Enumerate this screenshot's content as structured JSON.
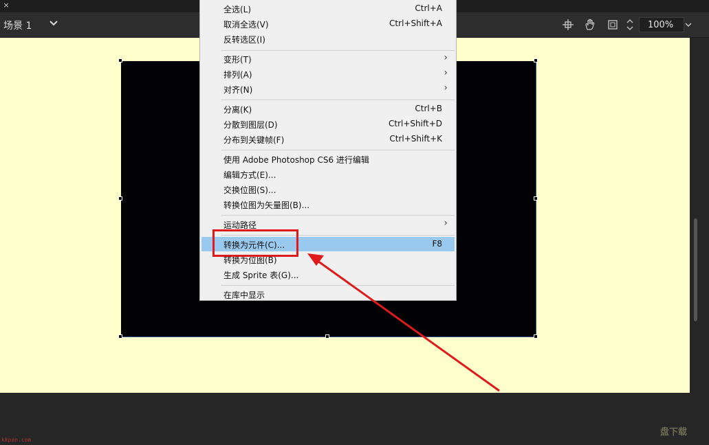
{
  "tab": {
    "close_glyph": "×"
  },
  "toolbar": {
    "scene_label": "场景 1",
    "zoom_value": "100%",
    "icons": [
      "center-stage-icon",
      "hand-tool-icon",
      "clip-stage-icon"
    ]
  },
  "context_menu": {
    "items": [
      {
        "label": "全选(L)",
        "shortcut": "Ctrl+A"
      },
      {
        "label": "取消全选(V)",
        "shortcut": "Ctrl+Shift+A"
      },
      {
        "label": "反转选区(I)",
        "shortcut": ""
      },
      {
        "label": "变形(T)",
        "submenu": true
      },
      {
        "label": "排列(A)",
        "submenu": true
      },
      {
        "label": "对齐(N)",
        "submenu": true
      },
      {
        "label": "分离(K)",
        "shortcut": "Ctrl+B"
      },
      {
        "label": "分散到图层(D)",
        "shortcut": "Ctrl+Shift+D"
      },
      {
        "label": "分布到关键帧(F)",
        "shortcut": "Ctrl+Shift+K"
      },
      {
        "label": "使用 Adobe Photoshop CS6 进行编辑",
        "shortcut": ""
      },
      {
        "label": "编辑方式(E)...",
        "shortcut": ""
      },
      {
        "label": "交换位图(S)...",
        "shortcut": ""
      },
      {
        "label": "转换位图为矢量图(B)...",
        "shortcut": ""
      },
      {
        "label": "运动路径",
        "submenu": true
      },
      {
        "label": "转换为元件(C)...",
        "shortcut": "F8",
        "highlighted": true
      },
      {
        "label": "转换为位图(B)",
        "shortcut": ""
      },
      {
        "label": "生成 Sprite 表(G)...",
        "shortcut": ""
      },
      {
        "label": "在库中显示",
        "shortcut": ""
      }
    ]
  },
  "watermark": {
    "url": "kkpan.com",
    "logo": "盘下载"
  },
  "colors": {
    "stage": "#ffffcc",
    "highlight": "#99c9ef",
    "annotation": "#e01a1a"
  }
}
